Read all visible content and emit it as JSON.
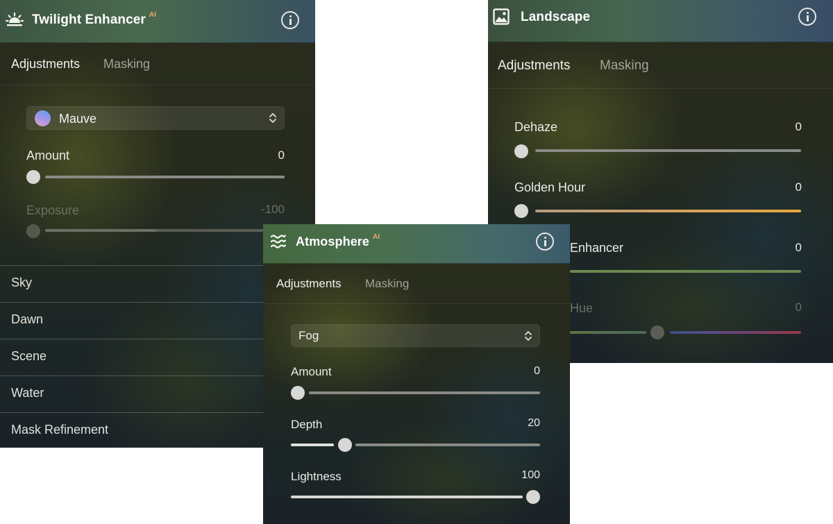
{
  "colors": {
    "header_twilight": "#3f5a45",
    "header_landscape": "#3a5060",
    "header_atmosphere": "#466a4e",
    "ai_badge": "#f0a868",
    "golden_hour": "#e3a444",
    "green_track": "#6d8a52"
  },
  "twilight": {
    "title": "Twilight Enhancer",
    "ai": "AI",
    "icon": "sunrise-icon",
    "tabs": [
      "Adjustments",
      "Masking"
    ],
    "preset": "Mauve",
    "sliders": [
      {
        "label": "Amount",
        "value": "0",
        "level": 0
      },
      {
        "label": "Exposure",
        "value": "-100",
        "level": 0
      }
    ],
    "sections": [
      "Sky",
      "Dawn",
      "Scene",
      "Water",
      "Mask Refinement"
    ]
  },
  "landscape": {
    "title": "Landscape",
    "icon": "image-icon",
    "tabs": [
      "Adjustments",
      "Masking"
    ],
    "sliders": [
      {
        "label": "Dehaze",
        "value": "0",
        "level": 0
      },
      {
        "label": "Golden Hour",
        "value": "0",
        "level": 0
      },
      {
        "label": "Enhancer",
        "value": "0",
        "level": 0
      },
      {
        "label": "Hue",
        "value": "0",
        "level": 0.5
      }
    ]
  },
  "atmosphere": {
    "title": "Atmosphere",
    "ai": "AI",
    "icon": "waves-icon",
    "tabs": [
      "Adjustments",
      "Masking"
    ],
    "preset": "Fog",
    "sliders": [
      {
        "label": "Amount",
        "value": "0",
        "level": 0
      },
      {
        "label": "Depth",
        "value": "20",
        "level": 0.2
      },
      {
        "label": "Lightness",
        "value": "100",
        "level": 1
      }
    ]
  }
}
